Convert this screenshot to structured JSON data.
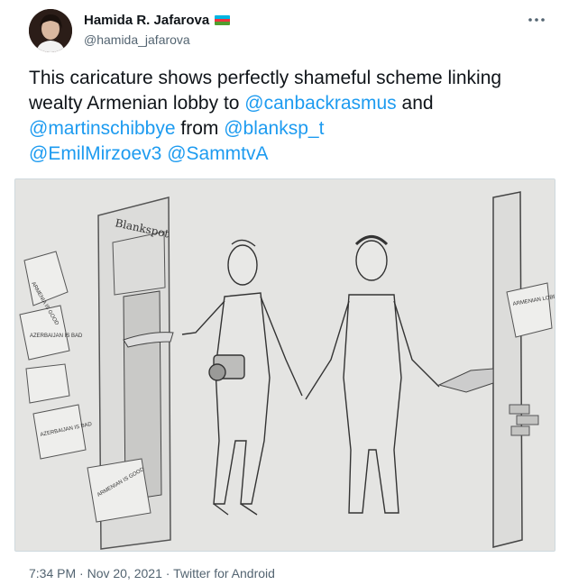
{
  "author": {
    "name": "Hamida R. Jafarova",
    "handle": "@hamida_jafarova"
  },
  "tweet": {
    "text_lead": "This caricature shows perfectly shameful scheme linking wealty Armenian lobby to ",
    "mention_1": "@canbackrasmus",
    "and_word": " and ",
    "mention_2": "@martinschibbye",
    "from_word": " from ",
    "mention_3": "@blanksp_t",
    "mention_4": "@EmilMirzoev3",
    "mention_5": "@SammtvA"
  },
  "image": {
    "sign_text": "Blankspot",
    "note_left_1": "ARMENIA IS GOOD",
    "note_left_2": "AZERBAIJAN IS BAD",
    "note_left_3": "AZERBAIJAN IS BAD",
    "note_left_4": "ARMENIAN IS GOOD",
    "note_right": "ARMENIAN LOBBY"
  },
  "meta": {
    "time": "7:34 PM",
    "separator": " · ",
    "date": "Nov 20, 2021",
    "source": "Twitter for Android"
  },
  "colors": {
    "mention_blue": "#1d9bf0",
    "secondary_gray": "#536471",
    "flag_blue": "#00b5e2",
    "flag_red": "#ef3340",
    "flag_green": "#509e2f"
  }
}
